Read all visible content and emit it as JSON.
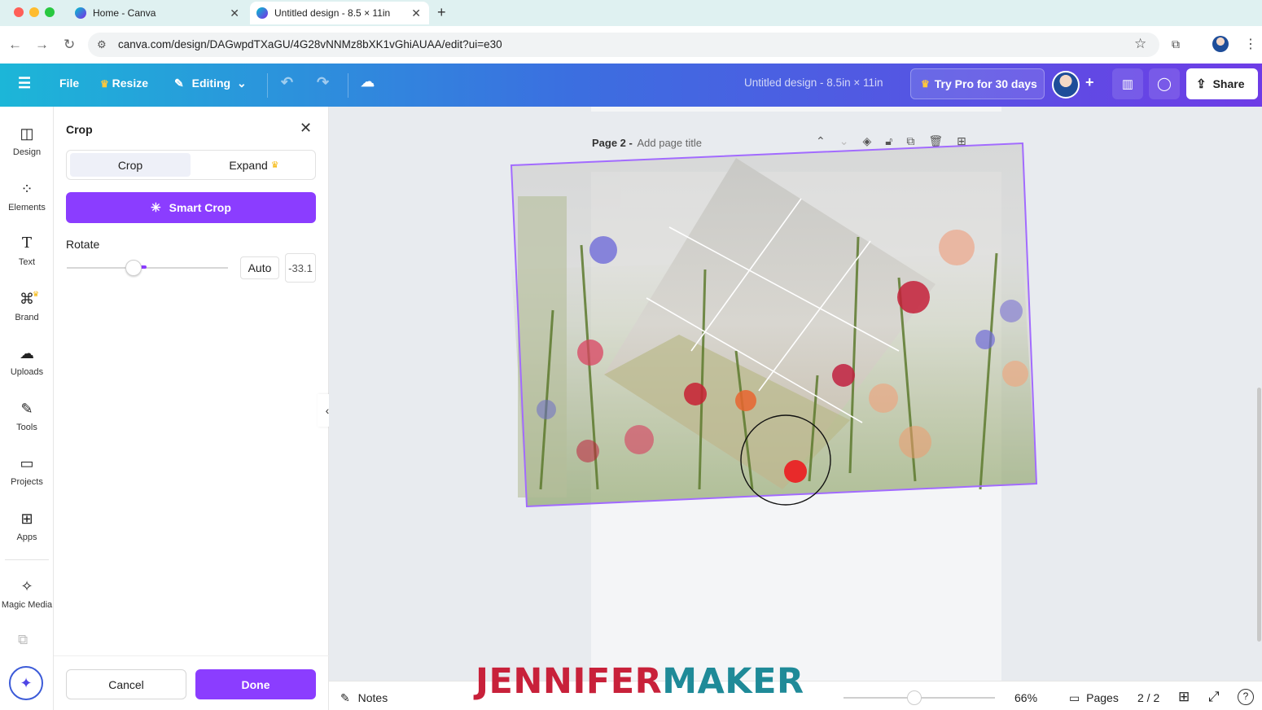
{
  "browser": {
    "tabs": [
      {
        "title": "Home - Canva",
        "active": false
      },
      {
        "title": "Untitled design - 8.5 × 11in",
        "active": true
      }
    ],
    "url": "canva.com/design/DAGwpdTXaGU/4G28vNNMz8bXK1vGhiAUAA/edit?ui=e30"
  },
  "topbar": {
    "file_label": "File",
    "resize_label": "Resize",
    "editing_label": "Editing",
    "doc_title": "Untitled design - 8.5in × 11in",
    "try_pro_label": "Try Pro for 30 days",
    "share_label": "Share"
  },
  "rail": {
    "items": [
      {
        "label": "Design",
        "icon": "design-icon"
      },
      {
        "label": "Elements",
        "icon": "elements-icon"
      },
      {
        "label": "Text",
        "icon": "text-icon"
      },
      {
        "label": "Brand",
        "icon": "brand-icon"
      },
      {
        "label": "Uploads",
        "icon": "uploads-icon"
      },
      {
        "label": "Tools",
        "icon": "tools-icon"
      },
      {
        "label": "Projects",
        "icon": "projects-icon"
      },
      {
        "label": "Apps",
        "icon": "apps-icon"
      },
      {
        "label": "Magic Media",
        "icon": "magic-media-icon"
      }
    ]
  },
  "panel": {
    "title": "Crop",
    "tab_crop": "Crop",
    "tab_expand": "Expand",
    "smart_crop_label": "Smart Crop",
    "rotate_label": "Rotate",
    "auto_label": "Auto",
    "rotate_value": "-33.1",
    "rotate_degrees": -33.1,
    "cancel_label": "Cancel",
    "done_label": "Done"
  },
  "canvas": {
    "page_label": "Page 2 -",
    "page_title_placeholder": "Add page title"
  },
  "bottombar": {
    "notes_label": "Notes",
    "zoom_label": "66%",
    "zoom_value": 66,
    "pages_label": "Pages",
    "page_count": "2 / 2"
  },
  "watermark": {
    "part1": "JENNIFER",
    "part2": "MAKER"
  },
  "colors": {
    "accent_purple": "#8b3dff",
    "topbar_start": "#1cb6d8",
    "topbar_end": "#6e3ce6",
    "logo_red": "#c8213a",
    "logo_teal": "#1f8a98"
  }
}
